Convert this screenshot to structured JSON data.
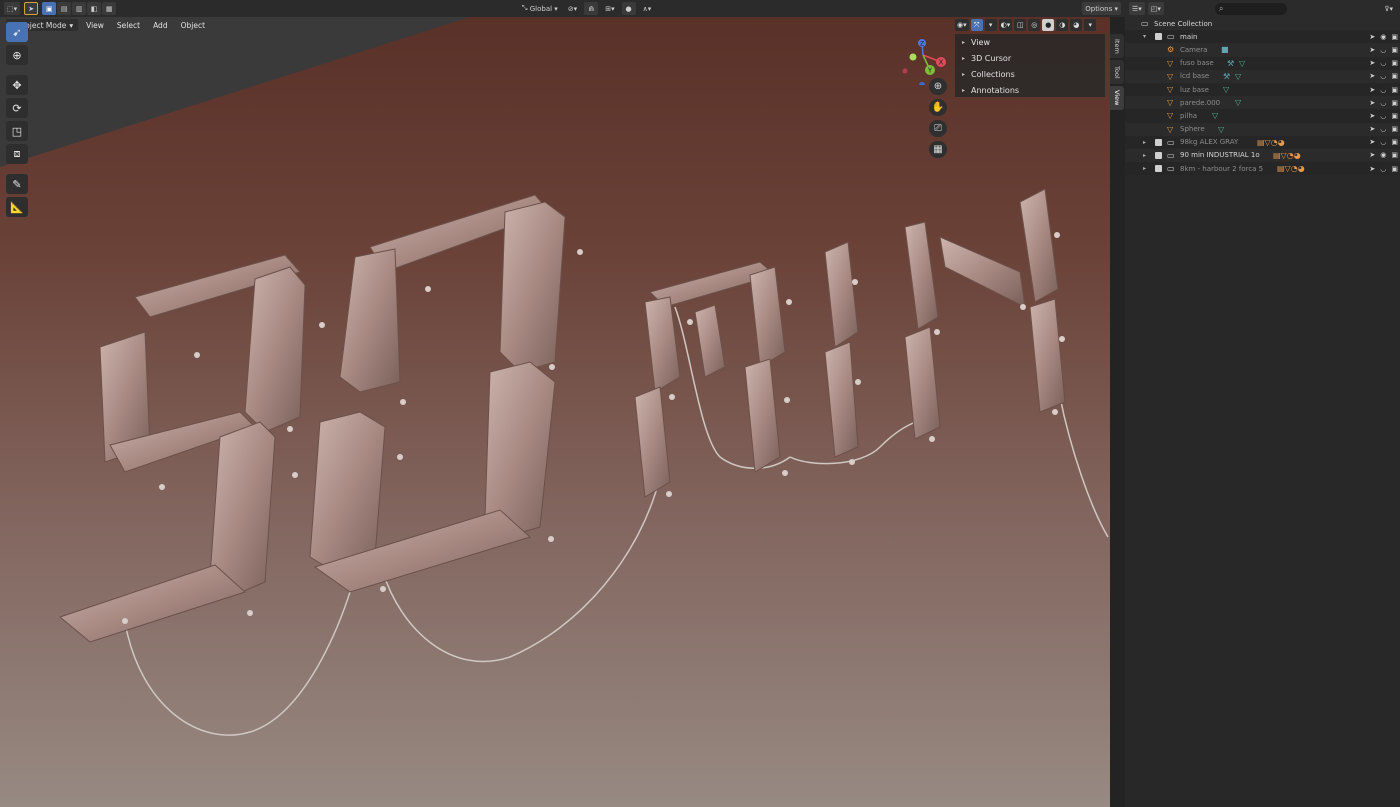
{
  "header": {
    "editor_icon": "view3d-icon",
    "transform_orientation": "Global",
    "options_label": "Options"
  },
  "subheader": {
    "mode_label": "Object Mode",
    "menus": [
      "View",
      "Select",
      "Add",
      "Object"
    ]
  },
  "npanel": {
    "sections": [
      "View",
      "3D Cursor",
      "Collections",
      "Annotations"
    ],
    "tabs": [
      "Item",
      "Tool",
      "View"
    ]
  },
  "gizmo": {
    "x_label": "X",
    "y_label": "Y",
    "z_label": "Z"
  },
  "outliner": {
    "root_label": "Scene Collection",
    "items": [
      {
        "label": "main",
        "type": "collection"
      },
      {
        "label": "Camera",
        "type": "camera"
      },
      {
        "label": "fuso base",
        "type": "object"
      },
      {
        "label": "lcd base",
        "type": "object"
      },
      {
        "label": "luz base",
        "type": "object"
      },
      {
        "label": "parede.000",
        "type": "object"
      },
      {
        "label": "pilha",
        "type": "object"
      },
      {
        "label": "Sphere",
        "type": "object"
      },
      {
        "label": "98kg ALEX GRAY",
        "type": "collection"
      },
      {
        "label": "90 min INDUSTRIAL 1o",
        "type": "collection"
      },
      {
        "label": "8km - harbour 2 forca 5",
        "type": "collection"
      }
    ]
  },
  "colors": {
    "accent": "#4772b3",
    "wall_top": "#5a3128",
    "wall_bottom": "#978a82",
    "segment": "#b89c95"
  }
}
